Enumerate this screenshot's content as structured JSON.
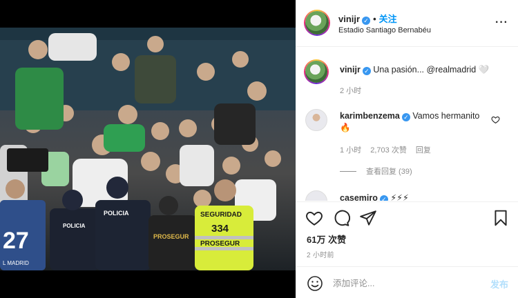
{
  "post": {
    "username": "vinijr",
    "follow_label": "关注",
    "location": "Estadio Santiago Bernabéu",
    "more_label": "···"
  },
  "caption": {
    "username": "vinijr",
    "text": "Una pasión... @realmadrid 🤍",
    "time": "2 小时"
  },
  "comments": [
    {
      "username": "karimbenzema",
      "text": "Vamos hermanito🔥",
      "time": "1 小时",
      "likes": "2,703 次赞",
      "reply_label": "回复",
      "view_replies": "查看回复 (39)"
    },
    {
      "username": "casemiro",
      "text": "⚡⚡⚡"
    }
  ],
  "stats": {
    "likes": "61万 次赞",
    "posted": "2 小时前"
  },
  "comment_box": {
    "placeholder": "添加评论...",
    "post_label": "发布"
  },
  "photo": {
    "security_vest_line1": "SEGURIDAD",
    "security_vest_number": "334",
    "security_vest_brand": "PROSEGUR",
    "police_label_1": "POLICIA",
    "police_label_2": "POLICIA",
    "prosegur_jacket": "PROSEGUR",
    "shirt_number": "27",
    "shirt_text": "L MADRID"
  },
  "colors": {
    "link_blue": "#0095f6",
    "verified_blue": "#3897f0",
    "post_button_disabled": "#b2dffc",
    "muted_text": "#8e8e8e"
  }
}
